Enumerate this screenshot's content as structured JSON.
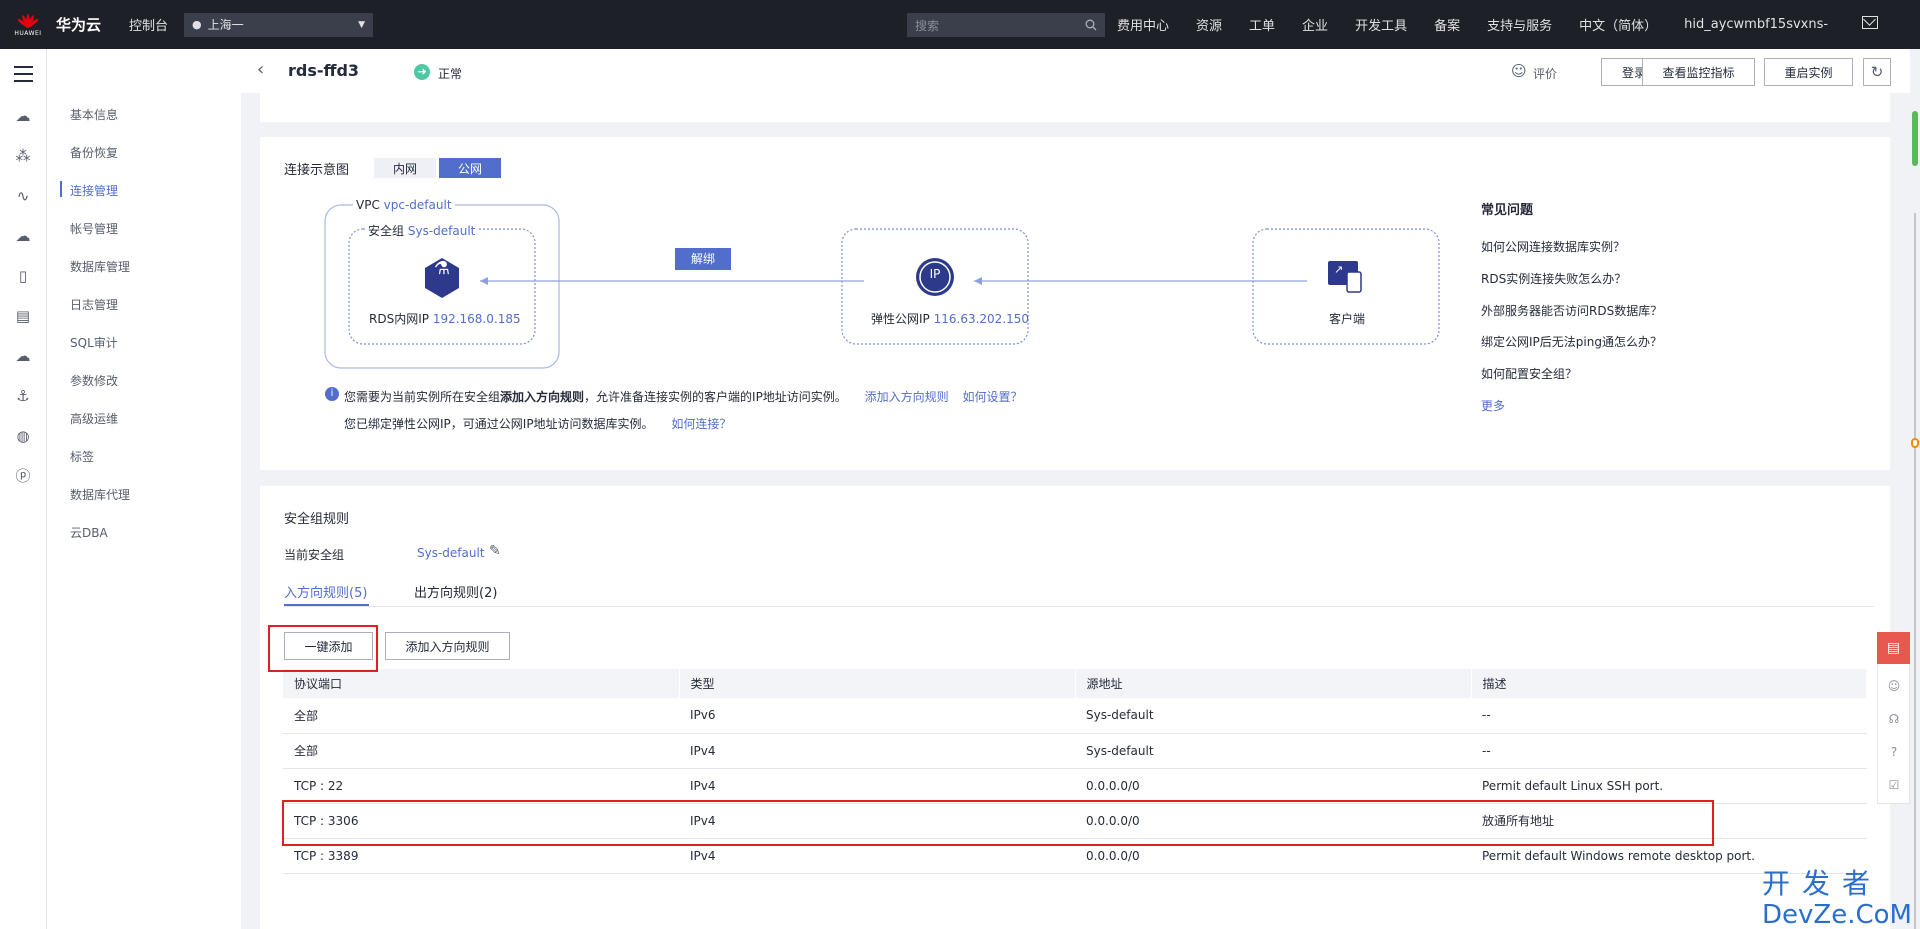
{
  "topbar": {
    "logo_text": "HUAWEI",
    "brand": "华为云",
    "console": "控制台",
    "region": "上海一",
    "search_placeholder": "搜索",
    "nav": [
      "费用中心",
      "资源",
      "工单",
      "企业",
      "开发工具",
      "备案",
      "支持与服务",
      "中文（简体）"
    ],
    "user": "hid_aycwmbf15svxns-"
  },
  "sidebar": {
    "items": [
      "基本信息",
      "备份恢复",
      "连接管理",
      "帐号管理",
      "数据库管理",
      "日志管理",
      "SQL审计",
      "参数修改",
      "高级运维",
      "标签",
      "数据库代理",
      "云DBA"
    ],
    "active": "连接管理"
  },
  "header": {
    "instance_name": "rds-ffd3",
    "status": "正常",
    "rate": "评价",
    "buttons": {
      "login": "登录",
      "monitor": "查看监控指标",
      "restart": "重启实例"
    }
  },
  "connection": {
    "title": "连接示意图",
    "tabs": [
      "内网",
      "公网"
    ],
    "active_tab": "公网",
    "vpc_label": "VPC",
    "vpc_name": "vpc-default",
    "sg_label": "安全组",
    "sg_name": "Sys-default",
    "rds_ip_label": "RDS内网IP",
    "rds_ip": "192.168.0.185",
    "unbind": "解绑",
    "eip_label": "弹性公网IP",
    "eip": "116.63.202.150",
    "client": "客户端",
    "ip_glyph": "IP",
    "tip1_pre": "您需要为当前实例所在安全组",
    "tip1_bold": "添加入方向规则",
    "tip1_post": "，允许准备连接实例的客户端的IP地址访问实例。",
    "tip1_link1": "添加入方向规则",
    "tip1_link2": "如何设置？",
    "tip2": "您已绑定弹性公网IP，可通过公网IP地址访问数据库实例。",
    "tip2_link": "如何连接？"
  },
  "faq": {
    "title": "常见问题",
    "items": [
      "如何公网连接数据库实例？",
      "RDS实例连接失败怎么办？",
      "外部服务器能否访问RDS数据库？",
      "绑定公网IP后无法ping通怎么办？",
      "如何配置安全组？"
    ],
    "more": "更多"
  },
  "sg_rules": {
    "title": "安全组规则",
    "current_label": "当前安全组",
    "current_value": "Sys-default",
    "tabs": [
      "入方向规则(5)",
      "出方向规则(2)"
    ],
    "active_tab": "入方向规则(5)",
    "btn_quick_add": "一键添加",
    "btn_add_inbound": "添加入方向规则",
    "columns": [
      "协议端口",
      "类型",
      "源地址",
      "描述"
    ],
    "rows": [
      [
        "全部",
        "IPv6",
        "Sys-default",
        "--"
      ],
      [
        "全部",
        "IPv4",
        "Sys-default",
        "--"
      ],
      [
        "TCP : 22",
        "IPv4",
        "0.0.0.0/0",
        "Permit default Linux SSH port."
      ],
      [
        "TCP : 3306",
        "IPv4",
        "0.0.0.0/0",
        "放通所有地址"
      ],
      [
        "TCP : 3389",
        "IPv4",
        "0.0.0.0/0",
        "Permit default Windows remote desktop port."
      ]
    ]
  },
  "watermark": {
    "line1": "开发者",
    "line2": "DevZe.CoM"
  },
  "colors": {
    "accent": "#526ecc",
    "topbar": "#1d2027",
    "highlight": "#e02020",
    "status_ok": "#50c7a3"
  }
}
